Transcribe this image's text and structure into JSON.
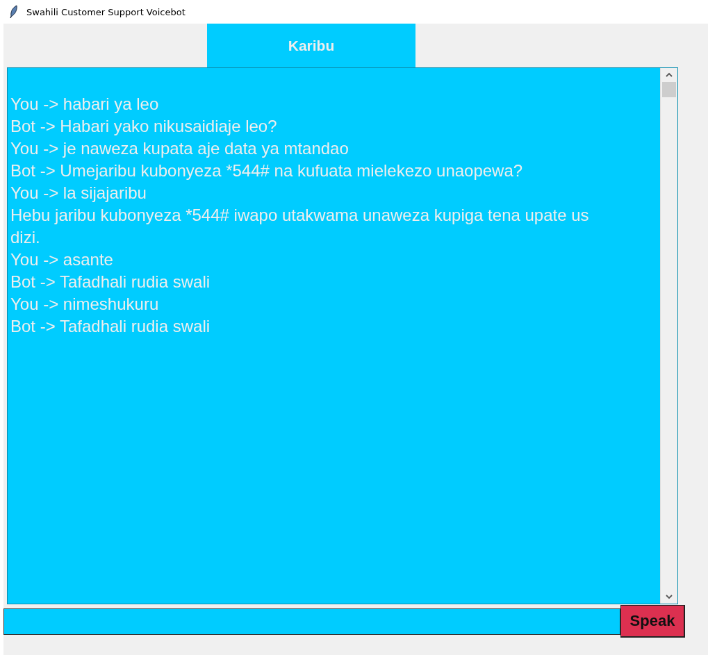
{
  "window": {
    "title": "Swahili Customer Support Voicebot"
  },
  "header": {
    "label": "Karibu"
  },
  "transcript": {
    "lines": [
      "You -> habari ya leo",
      "Bot -> Habari yako nikusaidiaje leo?",
      "You -> je naweza kupata aje data ya mtandao",
      "Bot -> Umejaribu kubonyeza *544# na kufuata mielekezo unaopewa?",
      "You -> la sijajaribu",
      "Hebu jaribu kubonyeza *544# iwapo utakwama unaweza kupiga tena upate us",
      "dizi.",
      "You -> asante",
      "Bot -> Tafadhali rudia swali",
      "You -> nimeshukuru",
      "Bot -> Tafadhali rudia swali"
    ]
  },
  "buttons": [
    "Speak"
  ]
}
